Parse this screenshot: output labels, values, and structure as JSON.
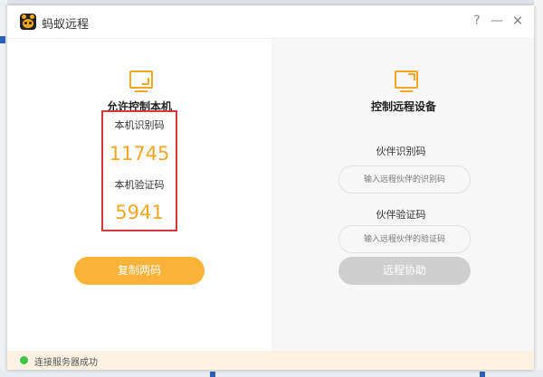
{
  "window": {
    "title": "蚂蚁远程"
  },
  "titlebar_buttons": {
    "help": "?",
    "minimize": "—",
    "close": "✕"
  },
  "left_panel": {
    "title": "允许控制本机",
    "id_label": "本机识别码",
    "id_value": "11745",
    "code_label": "本机验证码",
    "code_value": "5941",
    "copy_button": "复制两码"
  },
  "right_panel": {
    "title": "控制远程设备",
    "partner_id_label": "伙伴识别码",
    "partner_id_placeholder": "输入远程伙伴的识别码",
    "partner_code_label": "伙伴验证码",
    "partner_code_placeholder": "输入远程伙伴的验证码",
    "assist_button": "远程协助"
  },
  "status": {
    "text": "连接服务器成功",
    "dot_color": "#3ec449"
  },
  "colors": {
    "accent": "#f5a623",
    "highlight_box": "#d43a3a",
    "disabled_button": "#cfcfcf"
  }
}
